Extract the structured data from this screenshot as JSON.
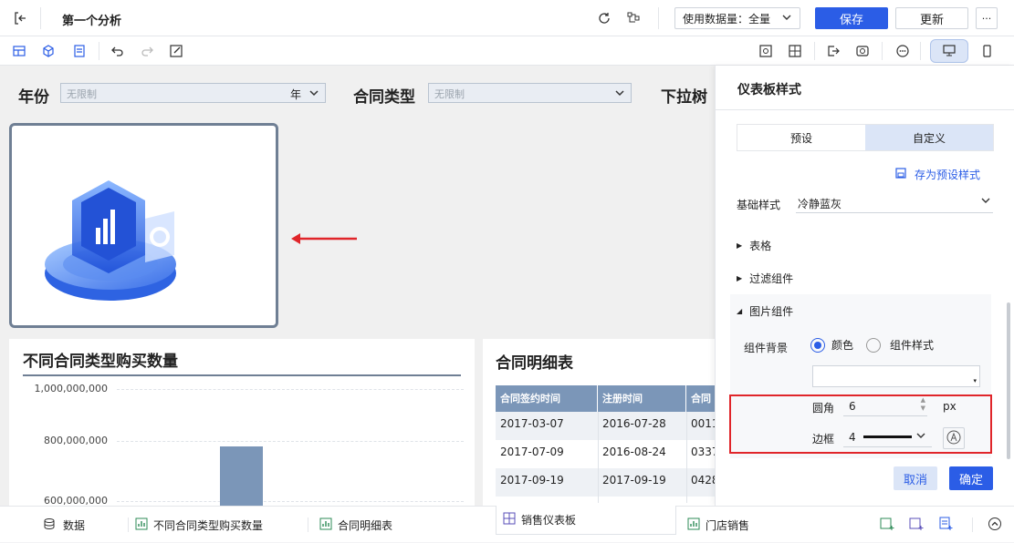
{
  "topbar": {
    "title": "第一个分析",
    "data_usage_label": "使用数据量：全量",
    "save": "保存",
    "update": "更新",
    "more": "···"
  },
  "filters": [
    {
      "label": "年份",
      "placeholder": "无限制",
      "unit": "年"
    },
    {
      "label": "合同类型",
      "placeholder": "无限制"
    },
    {
      "label": "下拉树"
    }
  ],
  "bar_widget": {
    "title": "不同合同类型购买数量",
    "chart_data": {
      "type": "bar",
      "yticks": [
        "1,000,000,000",
        "800,000,000",
        "600,000,000"
      ],
      "ylim": [
        600000000,
        1000000000
      ],
      "values": [
        780000000
      ],
      "color": "#7b96b8"
    }
  },
  "table_widget": {
    "title": "合同明细表",
    "headers": [
      "合同签约时间",
      "注册时间",
      "合同"
    ],
    "rows": [
      [
        "2017-03-07",
        "2016-07-28",
        "0011"
      ],
      [
        "2017-07-09",
        "2016-08-24",
        "0337"
      ],
      [
        "2017-09-19",
        "2017-09-19",
        "0428"
      ]
    ]
  },
  "panel": {
    "title": "仪表板样式",
    "tabs": [
      "预设",
      "自定义"
    ],
    "save_preset": "存为预设样式",
    "base_style_label": "基础样式",
    "base_style_value": "冷静蓝灰",
    "section_table": "表格",
    "section_filter": "过滤组件",
    "section_image": "图片组件",
    "bg_label": "组件背景",
    "radio_color": "颜色",
    "radio_style": "组件样式",
    "radius_label": "圆角",
    "radius_value": "6",
    "radius_unit": "px",
    "border_label": "边框",
    "border_value": "4",
    "cancel": "取消",
    "confirm": "确定"
  },
  "bottom_tabs": [
    {
      "label": "数据",
      "icon": "database-icon"
    },
    {
      "label": "不同合同类型购买数量",
      "icon": "chart-icon"
    },
    {
      "label": "合同明细表",
      "icon": "chart-icon"
    },
    {
      "label": "销售仪表板",
      "icon": "dashboard-icon"
    },
    {
      "label": "门店销售",
      "icon": "chart-icon"
    }
  ],
  "colors": {
    "accent": "#2b5de6",
    "highlight": "#e0252a",
    "header": "#7b96b8"
  }
}
